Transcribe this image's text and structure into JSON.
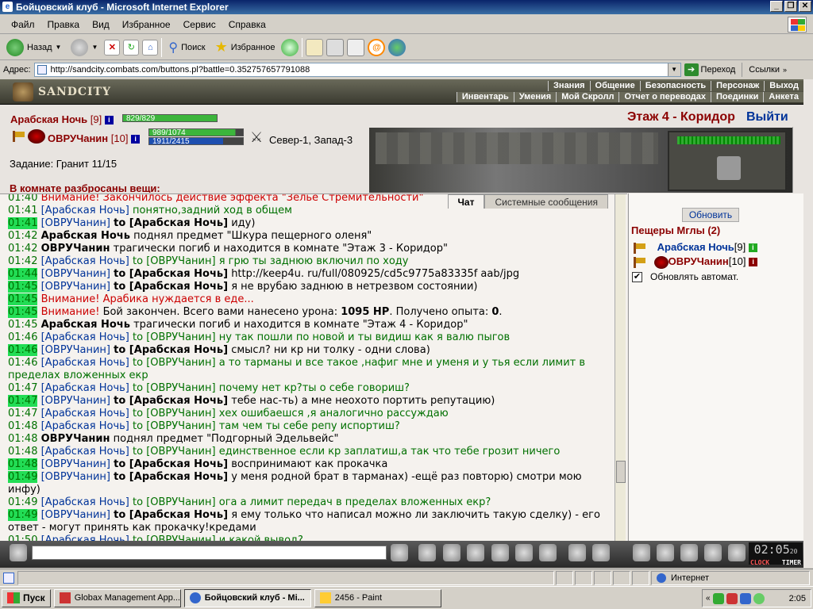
{
  "window": {
    "title": "Бойцовский клуб - Microsoft Internet Explorer"
  },
  "menu": [
    "Файл",
    "Правка",
    "Вид",
    "Избранное",
    "Сервис",
    "Справка"
  ],
  "toolbar": {
    "back": "Назад",
    "search": "Поиск",
    "favorites": "Избранное"
  },
  "address": {
    "label": "Адрес:",
    "url": "http://sandcity.combats.com/buttons.pl?battle=0.352757657791088",
    "go": "Переход",
    "links": "Ссылки"
  },
  "game": {
    "logo": "SANDCITY",
    "menu_row1": [
      "Знания",
      "Общение",
      "Безопасность",
      "Персонаж",
      "Выход"
    ],
    "menu_row2": [
      "Инвентарь",
      "Умения",
      "Мой Скролл",
      "Отчет о переводах",
      "Поединки",
      "Анкета"
    ],
    "hero1": {
      "name": "Арабская Ночь",
      "level": "[9]",
      "hp": "829/829"
    },
    "hero2": {
      "name": "ОВРУЧанин",
      "level": "[10]",
      "hp": "989/1074",
      "mp": "1911/2415"
    },
    "coords": "Север-1, Запад-3",
    "task": "Задание: Гранит 11/15",
    "items_header": "В комнате разбросаны вещи:",
    "location": "Этаж 4 - Коридор",
    "exit": "Выйти"
  },
  "tabs": {
    "chat": "Чат",
    "system": "Системные сообщения"
  },
  "chat": {
    "top_partial": "Внимание! Закончилось действие эффекта \"Зелье Стремительности\"",
    "lines": [
      {
        "t": "01:41",
        "who": "[Арабская Ночь]",
        "kind": "n",
        "msg": "понятно,задний ход в общем"
      },
      {
        "t": "01:41",
        "hl": true,
        "who": "[ОВРУЧанин]",
        "kind": "b",
        "to": "to [Арабская Ночь]",
        "msg": "иду)"
      },
      {
        "t": "01:42",
        "who": "Арабская Ночь",
        "kind": "sys",
        "msg": "поднял предмет \"Шкура пещерного оленя\""
      },
      {
        "t": "01:42",
        "who": "ОВРУЧанин",
        "kind": "sys",
        "msg": "трагически погиб и находится в комнате \"Этаж 3 - Коридор\""
      },
      {
        "t": "01:42",
        "who": "[Арабская Ночь]",
        "kind": "n",
        "to": "to [ОВРУЧанин]",
        "msg": "я грю ты заднюю включил по ходу"
      },
      {
        "t": "01:44",
        "hl": true,
        "who": "[ОВРУЧанин]",
        "kind": "b",
        "to": "to [Арабская Ночь]",
        "msg": "http://keep4u. ru/full/080925/cd5c9775a83335f aab/jpg"
      },
      {
        "t": "01:45",
        "hl": true,
        "who": "[ОВРУЧанин]",
        "kind": "b",
        "to": "to [Арабская Ночь]",
        "msg": "я не врубаю заднюю в нетрезвом состоянии)"
      },
      {
        "t": "01:45",
        "hl": true,
        "who": "Внимание!",
        "kind": "w",
        "msg": "Арабика нуждается в еде..."
      },
      {
        "t": "01:45",
        "hl": true,
        "who": "Внимание!",
        "kind": "w2",
        "msg": "Бой закончен. Всего вами нанесено урона: ",
        "b1": "1095 HP",
        "mid": ". Получено опыта: ",
        "b2": "0",
        "end": "."
      },
      {
        "t": "01:45",
        "who": "Арабская Ночь",
        "kind": "sys",
        "msg": "трагически погиб и находится в комнате \"Этаж 4 - Коридор\""
      },
      {
        "t": "01:46",
        "who": "[Арабская Ночь]",
        "kind": "n",
        "to": "to [ОВРУЧанин]",
        "msg": "ну так пошли по новой и ты видиш как я валю пыгов"
      },
      {
        "t": "01:46",
        "hl": true,
        "who": "[ОВРУЧанин]",
        "kind": "b",
        "to": "to [Арабская Ночь]",
        "msg": "смысл? ни кр ни толку - одни слова)"
      },
      {
        "t": "01:46",
        "who": "[Арабская Ночь]",
        "kind": "n",
        "to": "to [ОВРУЧанин]",
        "msg": "а то тарманы и все такое ,нафиг мне и уменя и у тья если лимит в пределах вложенных екр"
      },
      {
        "t": "01:47",
        "who": "[Арабская Ночь]",
        "kind": "n",
        "to": "to [ОВРУЧанин]",
        "msg": "почему нет кр?ты о себе говориш?"
      },
      {
        "t": "01:47",
        "hl": true,
        "who": "[ОВРУЧанин]",
        "kind": "b",
        "to": "to [Арабская Ночь]",
        "msg": "тебе нас-ть) а мне неохото портить репутацию)"
      },
      {
        "t": "01:47",
        "who": "[Арабская Ночь]",
        "kind": "n",
        "to": "to [ОВРУЧанин]",
        "msg": "хех ошибаешся ,я аналогично рассуждаю"
      },
      {
        "t": "01:48",
        "who": "[Арабская Ночь]",
        "kind": "n",
        "to": "to [ОВРУЧанин]",
        "msg": "там чем ты себе репу испортиш?"
      },
      {
        "t": "01:48",
        "who": "ОВРУЧанин",
        "kind": "sys",
        "msg": "поднял предмет \"Подгорный Эдельвейс\""
      },
      {
        "t": "01:48",
        "who": "[Арабская Ночь]",
        "kind": "n",
        "to": "to [ОВРУЧанин]",
        "msg": "единственное если кр заплатиш,а так что тебе грозит ничего"
      },
      {
        "t": "01:48",
        "hl": true,
        "who": "[ОВРУЧанин]",
        "kind": "b",
        "to": "to [Арабская Ночь]",
        "msg": "воспринимают как прокачка"
      },
      {
        "t": "01:49",
        "hl": true,
        "who": "[ОВРУЧанин]",
        "kind": "b",
        "to": "to [Арабская Ночь]",
        "msg": "у меня родной брат в тарманах) -ещё раз повторю) смотри мою инфу)"
      },
      {
        "t": "01:49",
        "who": "[Арабская Ночь]",
        "kind": "n",
        "to": "to [ОВРУЧанин]",
        "msg": "ога а лимит передач в пределах вложенных екр?"
      },
      {
        "t": "01:49",
        "hl": true,
        "who": "[ОВРУЧанин]",
        "kind": "b",
        "to": "to [Арабская Ночь]",
        "msg": "я ему только что написал можно ли заключить такую сделку) - его ответ - могут принять как прокачку!кредами"
      },
      {
        "t": "01:50",
        "who": "[Арабская Ночь]",
        "kind": "n",
        "to": "to [ОВРУЧанин]",
        "msg": "и какой вывод?"
      }
    ]
  },
  "side": {
    "refresh": "Обновить",
    "room": "Пещеры Мглы (2)",
    "players": [
      {
        "name": "Арабская Ночь",
        "level": "[9]"
      },
      {
        "name": "ОВРУЧанин",
        "level": "[10]"
      }
    ],
    "auto": "Обновлять автомат."
  },
  "clock": {
    "time": "02:05",
    "sec": "20",
    "clock_label": "CLOCK",
    "timer_label": "TIMER"
  },
  "status": {
    "zone": "Интернет"
  },
  "taskbar": {
    "start": "Пуск",
    "items": [
      "Globax Management App...",
      "Бойцовский клуб - Mi...",
      "2456 - Paint"
    ],
    "time": "2:05"
  }
}
